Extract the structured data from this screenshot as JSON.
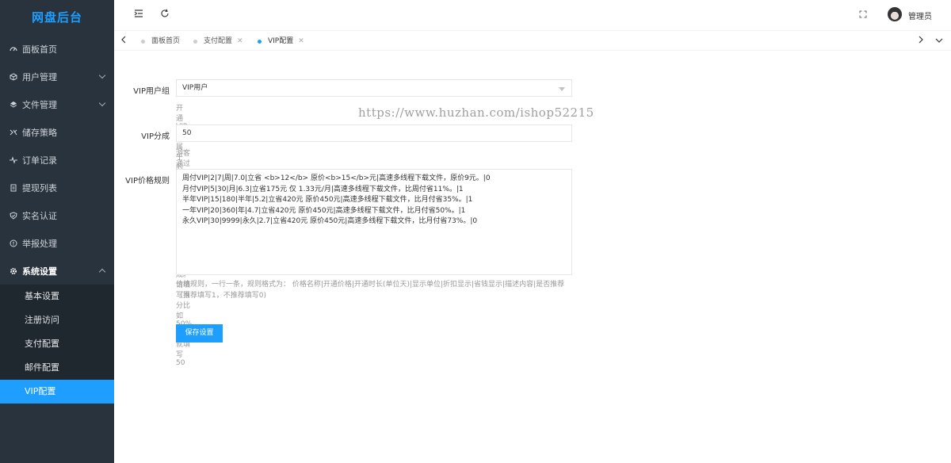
{
  "app": {
    "title": "网盘后台"
  },
  "sidebar": {
    "items": [
      {
        "label": "面板首页",
        "icon": "dashboard-icon"
      },
      {
        "label": "用户管理",
        "icon": "user-cube-icon",
        "expandable": true
      },
      {
        "label": "文件管理",
        "icon": "layers-icon",
        "expandable": true
      },
      {
        "label": "储存策略",
        "icon": "strategy-icon"
      },
      {
        "label": "订单记录",
        "icon": "pulse-icon"
      },
      {
        "label": "提现列表",
        "icon": "document-icon"
      },
      {
        "label": "实名认证",
        "icon": "shield-icon"
      },
      {
        "label": "举报处理",
        "icon": "alert-circle-icon"
      },
      {
        "label": "系统设置",
        "icon": "gear-icon",
        "expandable": true,
        "open": true
      }
    ],
    "submenu": [
      {
        "label": "基本设置"
      },
      {
        "label": "注册访问"
      },
      {
        "label": "支付配置"
      },
      {
        "label": "邮件配置"
      },
      {
        "label": "VIP配置",
        "active": true
      }
    ]
  },
  "topbar": {
    "menu_icon": "menu-toggle-icon",
    "refresh_icon": "refresh-icon",
    "fullscreen_icon": "fullscreen-icon",
    "user_name": "管理员"
  },
  "tabs": [
    {
      "label": "面板首页",
      "closable": false
    },
    {
      "label": "支付配置",
      "closable": true
    },
    {
      "label": "VIP配置",
      "closable": true,
      "active": true
    }
  ],
  "form": {
    "vip_group": {
      "label": "VIP用户组",
      "value": "VIP用户",
      "tip": "开通VIP后属于的用户组"
    },
    "share": {
      "label": "VIP分成",
      "value": "50",
      "tip": "游客通过分享者的链接开通VIP后，分享者获得的提成。请填写百分比如50%那么就填写50"
    },
    "price_rules": {
      "label": "VIP价格规则",
      "value": "周付VIP|2|7|周|7.0|立省 <b>12</b> 原价<b>15</b>元|高速多线程下载文件，原价9元。|0\n月付VIP|5|30|月|6.3|立省175元 仅 1.33元/月|高速多线程下载文件，比周付省11%。|1\n半年VIP|15|180|半年|5.2|立省420元 原价450元|高速多线程下载文件，比月付省35%。|1\n一年VIP|20|360|年|4.7|立省420元 原价450元|高速多线程下载文件，比月付省50%。|1\n永久VIP|30|9999|永久|2.7|立省420元 原价450元|高速多线程下载文件，比月付省73%。|0",
      "tip": "价格规则，一行一条，规则格式为： 价格名称|开通价格|开通时长(单位天)|显示单位|折扣显示|省钱显示|描述内容|是否推荐（推荐填写1，不推荐填写0)"
    },
    "save_label": "保存设置"
  },
  "watermark": "https://www.huzhan.com/ishop52215",
  "colors": {
    "sidebar_bg": "#28333e",
    "accent": "#1e9fff"
  }
}
